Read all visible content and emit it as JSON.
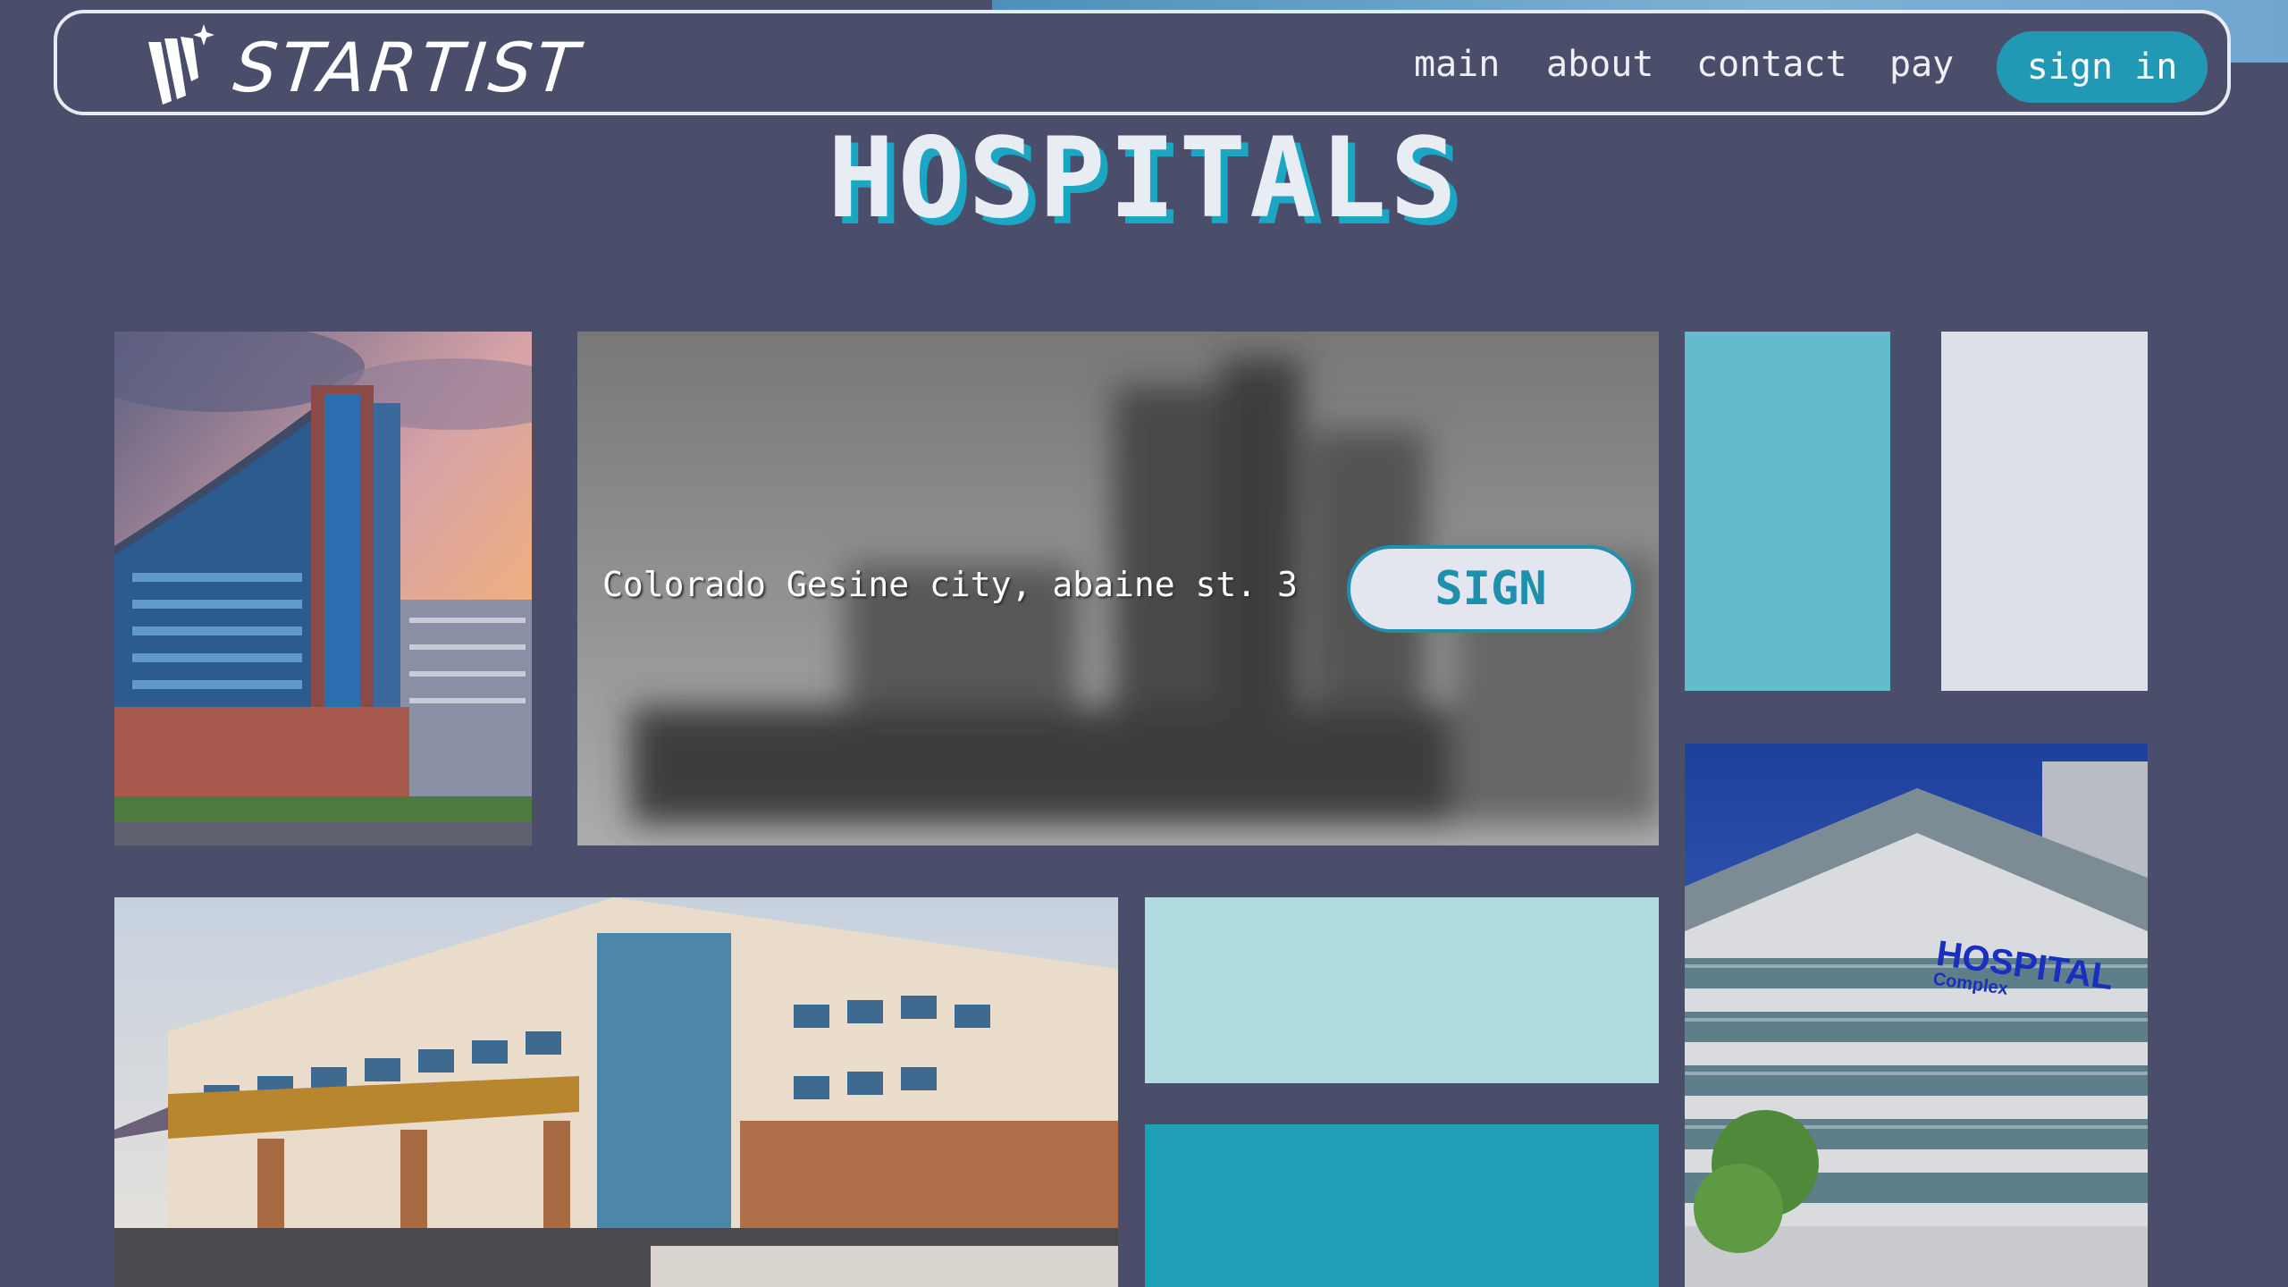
{
  "brand": {
    "name": "STARTIST"
  },
  "nav": {
    "items": [
      {
        "label": "main"
      },
      {
        "label": "about"
      },
      {
        "label": "contact"
      },
      {
        "label": "pay"
      }
    ],
    "signin_label": "sign in"
  },
  "page": {
    "title": "HOSPITALS"
  },
  "hero": {
    "address": "Colorado Gesine city, abaine st. 3",
    "sign_label": "SIGN"
  },
  "building_sign": {
    "line1": "HOSPITAL",
    "line2": "Complex"
  },
  "colors": {
    "background": "#4b4e6b",
    "accent": "#2199b4",
    "teal_light": "#63bccb",
    "pale_gray": "#dde0e8",
    "pale_cyan": "#b0dbe1",
    "teal_dark": "#20a0b7"
  }
}
